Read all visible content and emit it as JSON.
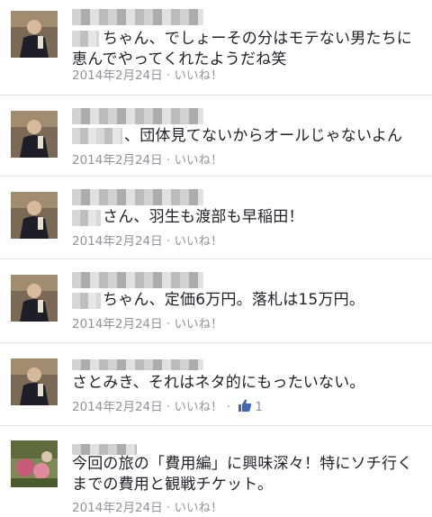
{
  "comments": [
    {
      "text": "ちゃん、でしょーその分はモテない男たちに\n恵んでやってくれたようだね笑",
      "date": "2014年2月24日",
      "like_label": "いいね！"
    },
    {
      "text": "、団体見てないからオールじゃないよん",
      "date": "2014年2月24日",
      "like_label": "いいね！"
    },
    {
      "text": "さん、羽生も渡部も早稲田！",
      "date": "2014年2月24日",
      "like_label": "いいね！"
    },
    {
      "text": "ちゃん、定価6万円。落札は15万円。",
      "date": "2014年2月24日",
      "like_label": "いいね！"
    },
    {
      "text": "さとみき、それはネタ的にもったいない。",
      "date": "2014年2月24日",
      "like_label": "いいね！",
      "like_count": "1",
      "like_icon": "thumbs-up-icon"
    },
    {
      "text": "今回の旅の「費用編」に興味深々！特にソチ行く\nまでの費用と観戦チケット。",
      "date": "2014年2月24日",
      "like_label": "いいね！"
    }
  ],
  "separator": " · ",
  "colors": {
    "text": "#1d2129",
    "meta": "#90949c",
    "like_blue": "#4267b2",
    "divider": "#e3e4e8"
  }
}
